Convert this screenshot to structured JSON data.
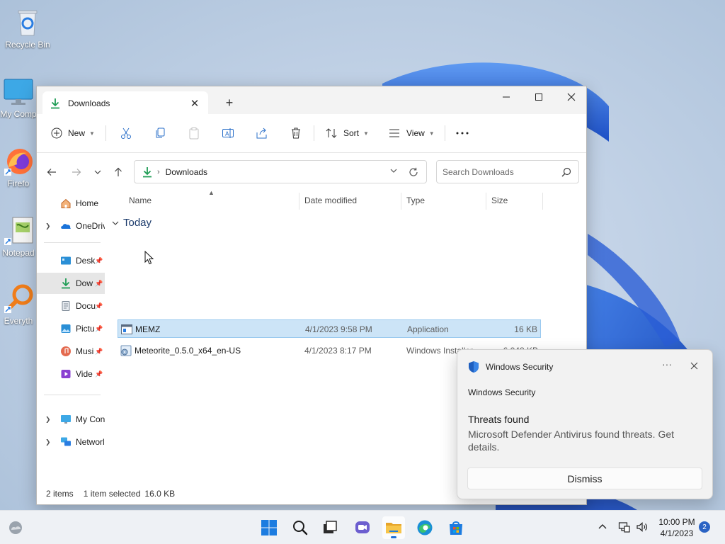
{
  "desktop": {
    "icons": [
      {
        "label": "Recycle Bin",
        "icon": "recycle-bin-icon"
      },
      {
        "label": "My Comp",
        "icon": "computer-icon"
      },
      {
        "label": "Firefo",
        "icon": "firefox-icon"
      },
      {
        "label": "Notepad",
        "icon": "notepad-icon"
      },
      {
        "label": "Everyth",
        "icon": "everything-search-icon"
      }
    ]
  },
  "explorer": {
    "tab": {
      "title": "Downloads",
      "icon": "downloads-icon"
    },
    "toolbar": {
      "new_label": "New",
      "sort_label": "Sort",
      "view_label": "View"
    },
    "address": {
      "path": [
        "Downloads"
      ]
    },
    "search": {
      "placeholder": "Search Downloads"
    },
    "nav": {
      "items": [
        {
          "label": "Home",
          "icon": "home-icon"
        },
        {
          "label": "OneDriv",
          "icon": "onedrive-icon"
        },
        {
          "label": "Desk",
          "icon": "desktop-folder-icon"
        },
        {
          "label": "Dow",
          "icon": "downloads-icon"
        },
        {
          "label": "Docu",
          "icon": "documents-icon"
        },
        {
          "label": "Pictu",
          "icon": "pictures-icon"
        },
        {
          "label": "Musi",
          "icon": "music-icon"
        },
        {
          "label": "Vide",
          "icon": "videos-icon"
        },
        {
          "label": "My Con",
          "icon": "computer-icon"
        },
        {
          "label": "Networl",
          "icon": "network-icon"
        }
      ]
    },
    "columns": {
      "name": "Name",
      "date": "Date modified",
      "type": "Type",
      "size": "Size"
    },
    "group": "Today",
    "files": [
      {
        "name": "MEMZ",
        "date": "4/1/2023 9:58 PM",
        "type": "Application",
        "size": "16 KB",
        "icon": "application-icon"
      },
      {
        "name": "Meteorite_0.5.0_x64_en-US",
        "date": "4/1/2023 8:17 PM",
        "type": "Windows Installer ...",
        "size": "6,048 KB",
        "icon": "installer-icon"
      }
    ],
    "status": {
      "count": "2 items",
      "selected": "1 item selected",
      "selected_size": "16.0 KB"
    }
  },
  "toast": {
    "app": "Windows Security",
    "attribution": "Windows Security",
    "title": "Threats found",
    "body": "Microsoft Defender Antivirus found threats. Get details.",
    "button": "Dismiss"
  },
  "taskbar": {
    "time": "10:00 PM",
    "date": "4/1/2023",
    "notification_count": "2",
    "icons": [
      "weather-icon",
      "start-icon",
      "search-icon",
      "task-view-icon",
      "chat-icon",
      "file-explorer-icon",
      "edge-icon",
      "store-icon"
    ]
  },
  "colors": {
    "accent": "#1c6fd6",
    "selection_bg": "#cce4f7",
    "download_green": "#1f9d55"
  }
}
